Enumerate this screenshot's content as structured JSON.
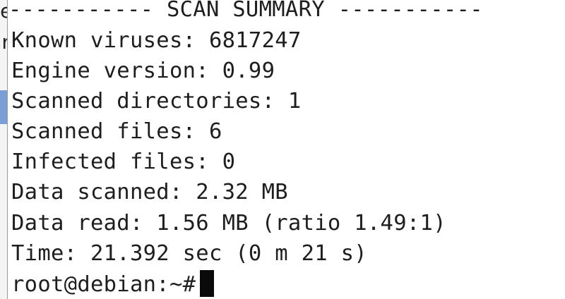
{
  "behind_window": {
    "visible_chars": [
      "e",
      "r"
    ]
  },
  "terminal": {
    "header": "----------- SCAN SUMMARY -----------",
    "lines": [
      "Known viruses: 6817247",
      "Engine version: 0.99",
      "Scanned directories: 1",
      "Scanned files: 6",
      "Infected files: 0",
      "Data scanned: 2.32 MB",
      "Data read: 1.56 MB (ratio 1.49:1)",
      "Time: 21.392 sec (0 m 21 s)"
    ],
    "prompt": "root@debian:~#"
  }
}
